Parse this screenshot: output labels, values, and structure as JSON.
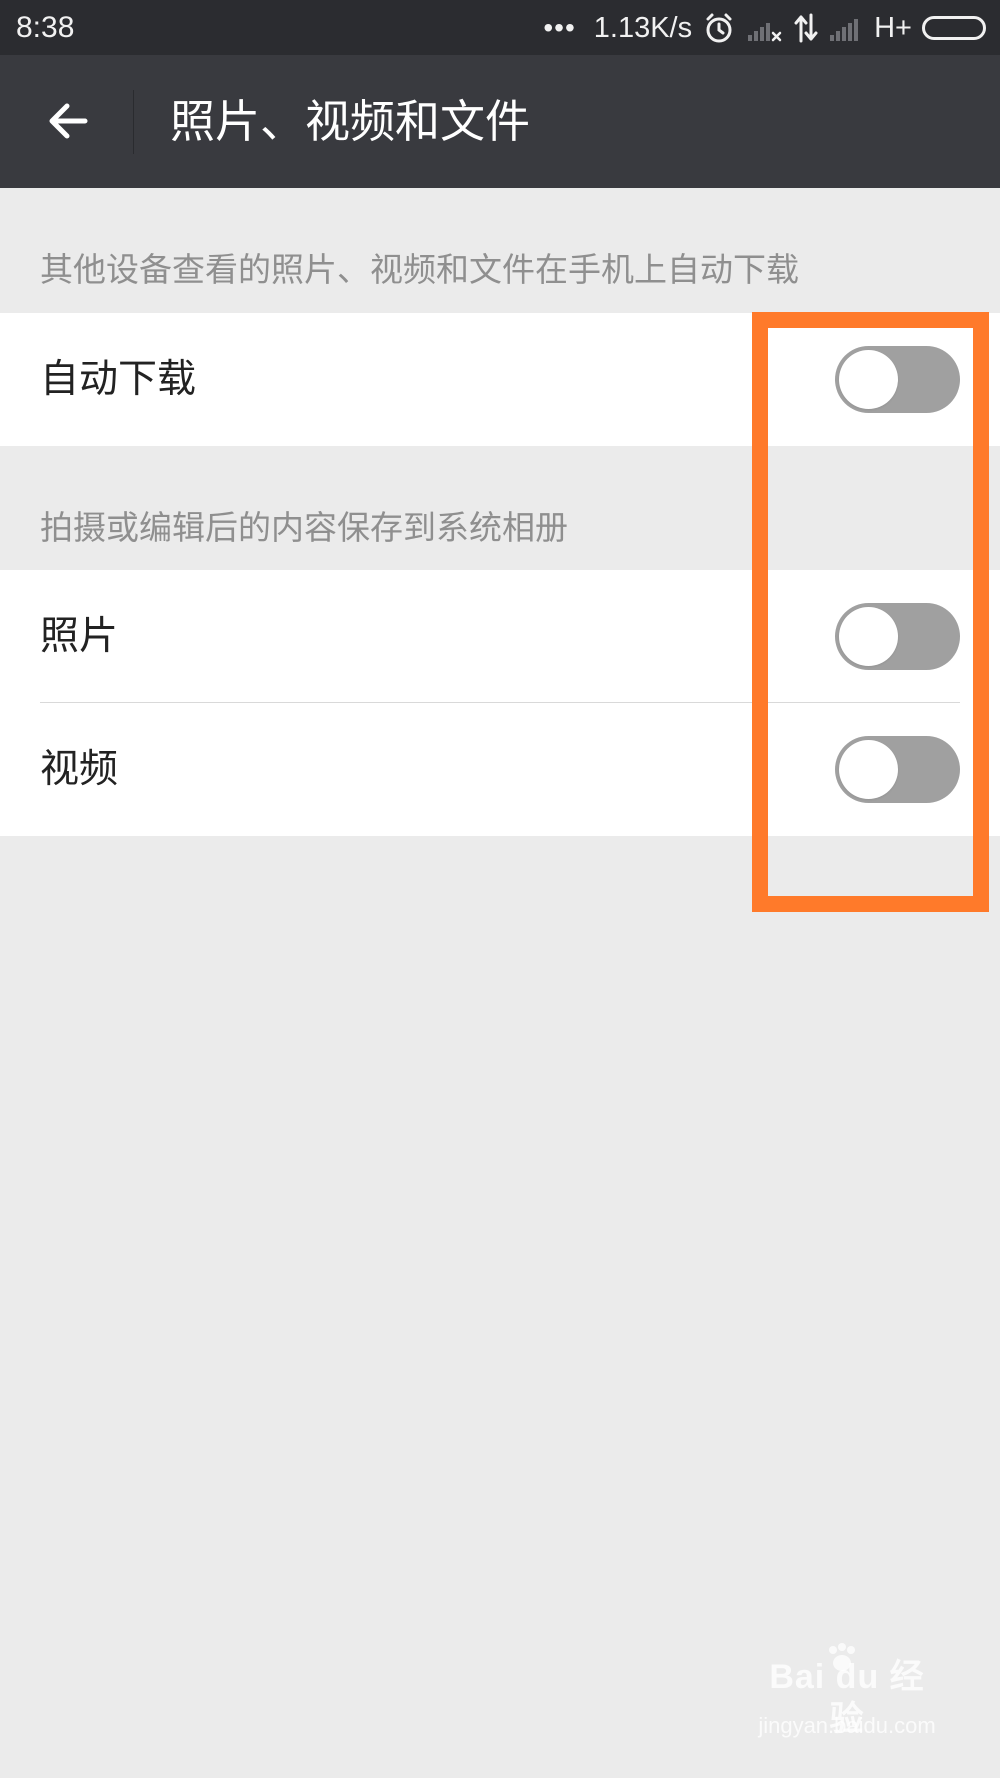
{
  "status_bar": {
    "time": "8:38",
    "more_label": "•••",
    "speed": "1.13K/s",
    "network_type": "H+",
    "icons": [
      "alarm-icon",
      "signal-no-sim-icon",
      "data-transfer-icon",
      "signal-strength-icon",
      "battery-icon"
    ],
    "battery_level": 1
  },
  "app_bar": {
    "back_icon": "arrow-left-icon",
    "title": "照片、视频和文件"
  },
  "sections": [
    {
      "note": "其他设备查看的照片、视频和文件在手机上自动下载",
      "items": [
        {
          "label": "自动下载",
          "enabled": false
        }
      ]
    },
    {
      "note": "拍摄或编辑后的内容保存到系统相册",
      "items": [
        {
          "label": "照片",
          "enabled": false
        },
        {
          "label": "视频",
          "enabled": false
        }
      ]
    }
  ],
  "annotation": {
    "color": "#ff7a2a"
  },
  "watermark": {
    "brand": "Bai du 经验",
    "url": "jingyan.baidu.com"
  },
  "colors": {
    "status_bar": "#2b2c30",
    "app_bar": "#393a3f",
    "background": "#ebebeb",
    "toggle_off": "#a0a0a0",
    "highlight": "#ff7a2a"
  }
}
